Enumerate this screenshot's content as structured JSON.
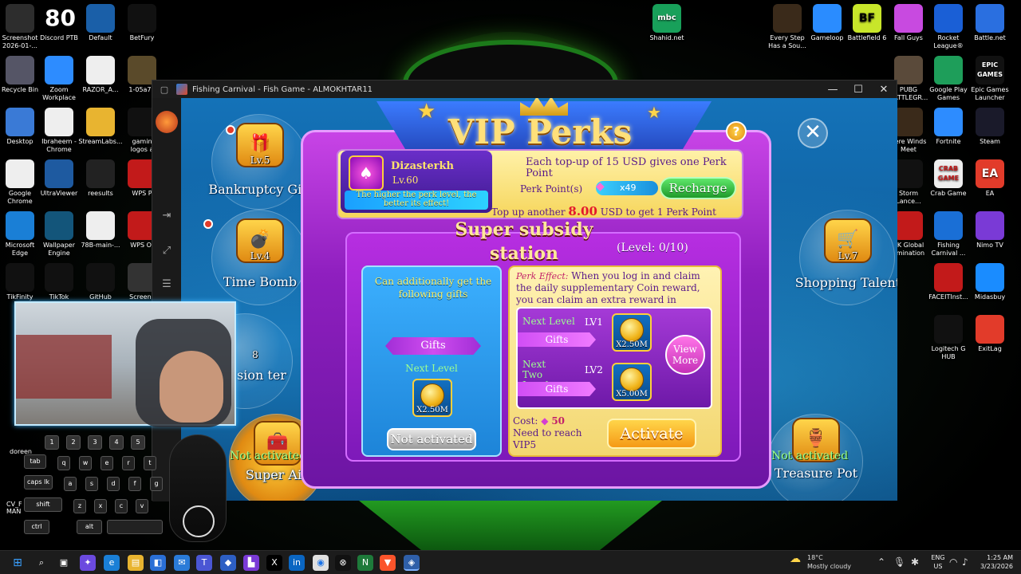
{
  "desktop": {
    "left_icons": [
      {
        "label": "Screenshot\n2026-01-..."
      },
      {
        "label": "80",
        "sub": "Discord PTB"
      },
      {
        "label": "Default"
      },
      {
        "label": "BetFury"
      },
      {
        "label": "Recycle Bin"
      },
      {
        "label": "Zoom\nWorkplace"
      },
      {
        "label": "RAZOR_A..."
      },
      {
        "label": "1-05a76"
      },
      {
        "label": "Desktop"
      },
      {
        "label": "Ibraheem -\nChrome"
      },
      {
        "label": "StreamLabs..."
      },
      {
        "label": "gamin\nlogos a"
      },
      {
        "label": "Google\nChrome"
      },
      {
        "label": "UltraViewer"
      },
      {
        "label": "reesults"
      },
      {
        "label": "WPS P"
      },
      {
        "label": "Microsoft\nEdge"
      },
      {
        "label": "Wallpaper\nEngine"
      },
      {
        "label": "78B-main-..."
      },
      {
        "label": "WPS Of"
      },
      {
        "label": "TikFinity"
      },
      {
        "label": "TikTok"
      },
      {
        "label": "GitHub"
      },
      {
        "label": "Screens"
      }
    ],
    "top_center_icon": {
      "label": "Shahid.net",
      "glyph": "mbc"
    },
    "right_icons": [
      {
        "label": "Every Step\nHas a Sou..."
      },
      {
        "label": "Gameloop"
      },
      {
        "label": "Battlefield 6",
        "glyph": "BF"
      },
      {
        "label": "Fall Guys"
      },
      {
        "label": "Rocket\nLeague®"
      },
      {
        "label": "Battle.net"
      },
      {
        "label": "PUBG\nBATTLEGR..."
      },
      {
        "label": "Google Play\nGames"
      },
      {
        "label": "Epic Games\nLauncher",
        "glyph": "EPIC GAMES"
      },
      {
        "label": "here Winds\nMeet"
      },
      {
        "label": "Fortnite"
      },
      {
        "label": "Steam"
      },
      {
        "label": "Storm\nLance..."
      },
      {
        "label": "Crab Game",
        "glyph": "CRAB GAME"
      },
      {
        "label": "EA",
        "glyph": "EA"
      },
      {
        "label": "SK Global\nomination"
      },
      {
        "label": "Fishing\nCarnival ..."
      },
      {
        "label": "Nimo TV"
      },
      {
        "label": "FACEITInst..."
      },
      {
        "label": "Midasbuy"
      },
      {
        "label": "Logitech G\nHUB"
      },
      {
        "label": "ExitLag"
      }
    ]
  },
  "window": {
    "title": "Fishing Carnival - Fish Game - ALMOKHTAR11",
    "controls": {
      "minimize": "—",
      "maximize": "☐",
      "close": "✕"
    }
  },
  "game": {
    "panel_title": "VIP Perks",
    "help": "?",
    "close": "✕",
    "user": {
      "name": "Dizasterkh",
      "level": "Lv.60",
      "tip": "The higher the perk level, the better its effect!"
    },
    "perk_info": "Each top-up of 15 USD gives one Perk Point",
    "perk_points_label": "Perk Point(s)",
    "perk_points_value": "x49",
    "recharge": "Recharge",
    "topup_prefix": "Top up another",
    "topup_amount": "8.00",
    "topup_suffix": "USD to get 1 Perk Point",
    "station_title": "Super subsidy station",
    "station_level": "(Level: 0/10)",
    "left_card": {
      "text": "Can additionally get the following gifts",
      "gifts_label": "Gifts",
      "next_level": "Next Level",
      "coin_value": "X2.50M",
      "status": "Not activated"
    },
    "right_card": {
      "effect_label": "Perk Effect:",
      "effect_text": "When you log in and claim the daily supplementary Coin reward, you can claim an extra reward in",
      "rows": [
        {
          "label": "Next Level",
          "code": "LV1",
          "gifts": "Gifts",
          "coin_value": "X2.50M"
        },
        {
          "label": "Next Two Levels",
          "code": "LV2",
          "gifts": "Gifts",
          "coin_value": "X5.00M"
        }
      ],
      "view_more": "View More",
      "cost_label": "Cost:",
      "cost_value": "50",
      "requirement": "Need to reach VIP5",
      "activate": "Activate"
    },
    "side_items": [
      {
        "name": "Bankruptcy Gift",
        "level": "Lv.5"
      },
      {
        "name": "Time Bomb",
        "level": "Lv.4"
      },
      {
        "name": "sion ter",
        "level": "8"
      },
      {
        "name": "Super Aid",
        "level": "",
        "status": "Not activated"
      },
      {
        "name": "Shopping Talent",
        "level": "Lv.7"
      },
      {
        "name": "Treasure Pot",
        "level": "",
        "status": "Not activated"
      }
    ]
  },
  "overlay": {
    "keyboard_numbers": [
      "1",
      "2",
      "3",
      "4",
      "5"
    ],
    "keyboard_row1": [
      "tab",
      "q",
      "w",
      "e",
      "r",
      "t"
    ],
    "keyboard_row2": [
      "caps lk",
      "a",
      "s",
      "d",
      "f",
      "g"
    ],
    "keyboard_row3": [
      "shift",
      "z",
      "x",
      "c",
      "v"
    ],
    "keyboard_row4": [
      "ctrl",
      "alt"
    ],
    "side_text_1": "doreen",
    "side_text_2": "CV_F\nMAN"
  },
  "taskbar": {
    "weather_temp": "18°C",
    "weather_text": "Mostly cloudy",
    "lang_1": "ENG",
    "lang_2": "US",
    "time": "1:25 AM",
    "date": "3/23/2026"
  }
}
